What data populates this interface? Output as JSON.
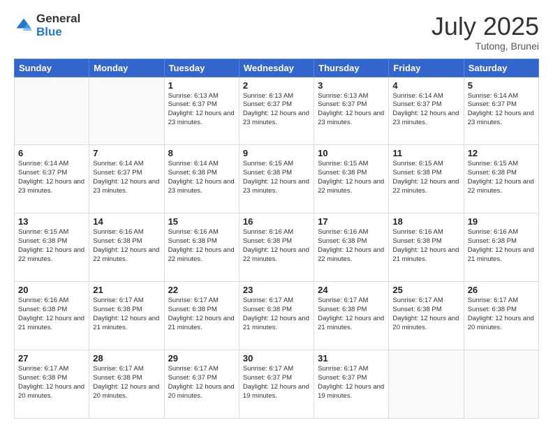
{
  "logo": {
    "general": "General",
    "blue": "Blue"
  },
  "title": "July 2025",
  "subtitle": "Tutong, Brunei",
  "days_header": [
    "Sunday",
    "Monday",
    "Tuesday",
    "Wednesday",
    "Thursday",
    "Friday",
    "Saturday"
  ],
  "weeks": [
    [
      {
        "day": "",
        "sunrise": "",
        "sunset": "",
        "daylight": ""
      },
      {
        "day": "",
        "sunrise": "",
        "sunset": "",
        "daylight": ""
      },
      {
        "day": "1",
        "sunrise": "Sunrise: 6:13 AM",
        "sunset": "Sunset: 6:37 PM",
        "daylight": "Daylight: 12 hours and 23 minutes."
      },
      {
        "day": "2",
        "sunrise": "Sunrise: 6:13 AM",
        "sunset": "Sunset: 6:37 PM",
        "daylight": "Daylight: 12 hours and 23 minutes."
      },
      {
        "day": "3",
        "sunrise": "Sunrise: 6:13 AM",
        "sunset": "Sunset: 6:37 PM",
        "daylight": "Daylight: 12 hours and 23 minutes."
      },
      {
        "day": "4",
        "sunrise": "Sunrise: 6:14 AM",
        "sunset": "Sunset: 6:37 PM",
        "daylight": "Daylight: 12 hours and 23 minutes."
      },
      {
        "day": "5",
        "sunrise": "Sunrise: 6:14 AM",
        "sunset": "Sunset: 6:37 PM",
        "daylight": "Daylight: 12 hours and 23 minutes."
      }
    ],
    [
      {
        "day": "6",
        "sunrise": "Sunrise: 6:14 AM",
        "sunset": "Sunset: 6:37 PM",
        "daylight": "Daylight: 12 hours and 23 minutes."
      },
      {
        "day": "7",
        "sunrise": "Sunrise: 6:14 AM",
        "sunset": "Sunset: 6:37 PM",
        "daylight": "Daylight: 12 hours and 23 minutes."
      },
      {
        "day": "8",
        "sunrise": "Sunrise: 6:14 AM",
        "sunset": "Sunset: 6:38 PM",
        "daylight": "Daylight: 12 hours and 23 minutes."
      },
      {
        "day": "9",
        "sunrise": "Sunrise: 6:15 AM",
        "sunset": "Sunset: 6:38 PM",
        "daylight": "Daylight: 12 hours and 23 minutes."
      },
      {
        "day": "10",
        "sunrise": "Sunrise: 6:15 AM",
        "sunset": "Sunset: 6:38 PM",
        "daylight": "Daylight: 12 hours and 22 minutes."
      },
      {
        "day": "11",
        "sunrise": "Sunrise: 6:15 AM",
        "sunset": "Sunset: 6:38 PM",
        "daylight": "Daylight: 12 hours and 22 minutes."
      },
      {
        "day": "12",
        "sunrise": "Sunrise: 6:15 AM",
        "sunset": "Sunset: 6:38 PM",
        "daylight": "Daylight: 12 hours and 22 minutes."
      }
    ],
    [
      {
        "day": "13",
        "sunrise": "Sunrise: 6:15 AM",
        "sunset": "Sunset: 6:38 PM",
        "daylight": "Daylight: 12 hours and 22 minutes."
      },
      {
        "day": "14",
        "sunrise": "Sunrise: 6:16 AM",
        "sunset": "Sunset: 6:38 PM",
        "daylight": "Daylight: 12 hours and 22 minutes."
      },
      {
        "day": "15",
        "sunrise": "Sunrise: 6:16 AM",
        "sunset": "Sunset: 6:38 PM",
        "daylight": "Daylight: 12 hours and 22 minutes."
      },
      {
        "day": "16",
        "sunrise": "Sunrise: 6:16 AM",
        "sunset": "Sunset: 6:38 PM",
        "daylight": "Daylight: 12 hours and 22 minutes."
      },
      {
        "day": "17",
        "sunrise": "Sunrise: 6:16 AM",
        "sunset": "Sunset: 6:38 PM",
        "daylight": "Daylight: 12 hours and 22 minutes."
      },
      {
        "day": "18",
        "sunrise": "Sunrise: 6:16 AM",
        "sunset": "Sunset: 6:38 PM",
        "daylight": "Daylight: 12 hours and 21 minutes."
      },
      {
        "day": "19",
        "sunrise": "Sunrise: 6:16 AM",
        "sunset": "Sunset: 6:38 PM",
        "daylight": "Daylight: 12 hours and 21 minutes."
      }
    ],
    [
      {
        "day": "20",
        "sunrise": "Sunrise: 6:16 AM",
        "sunset": "Sunset: 6:38 PM",
        "daylight": "Daylight: 12 hours and 21 minutes."
      },
      {
        "day": "21",
        "sunrise": "Sunrise: 6:17 AM",
        "sunset": "Sunset: 6:38 PM",
        "daylight": "Daylight: 12 hours and 21 minutes."
      },
      {
        "day": "22",
        "sunrise": "Sunrise: 6:17 AM",
        "sunset": "Sunset: 6:38 PM",
        "daylight": "Daylight: 12 hours and 21 minutes."
      },
      {
        "day": "23",
        "sunrise": "Sunrise: 6:17 AM",
        "sunset": "Sunset: 6:38 PM",
        "daylight": "Daylight: 12 hours and 21 minutes."
      },
      {
        "day": "24",
        "sunrise": "Sunrise: 6:17 AM",
        "sunset": "Sunset: 6:38 PM",
        "daylight": "Daylight: 12 hours and 21 minutes."
      },
      {
        "day": "25",
        "sunrise": "Sunrise: 6:17 AM",
        "sunset": "Sunset: 6:38 PM",
        "daylight": "Daylight: 12 hours and 20 minutes."
      },
      {
        "day": "26",
        "sunrise": "Sunrise: 6:17 AM",
        "sunset": "Sunset: 6:38 PM",
        "daylight": "Daylight: 12 hours and 20 minutes."
      }
    ],
    [
      {
        "day": "27",
        "sunrise": "Sunrise: 6:17 AM",
        "sunset": "Sunset: 6:38 PM",
        "daylight": "Daylight: 12 hours and 20 minutes."
      },
      {
        "day": "28",
        "sunrise": "Sunrise: 6:17 AM",
        "sunset": "Sunset: 6:38 PM",
        "daylight": "Daylight: 12 hours and 20 minutes."
      },
      {
        "day": "29",
        "sunrise": "Sunrise: 6:17 AM",
        "sunset": "Sunset: 6:37 PM",
        "daylight": "Daylight: 12 hours and 20 minutes."
      },
      {
        "day": "30",
        "sunrise": "Sunrise: 6:17 AM",
        "sunset": "Sunset: 6:37 PM",
        "daylight": "Daylight: 12 hours and 19 minutes."
      },
      {
        "day": "31",
        "sunrise": "Sunrise: 6:17 AM",
        "sunset": "Sunset: 6:37 PM",
        "daylight": "Daylight: 12 hours and 19 minutes."
      },
      {
        "day": "",
        "sunrise": "",
        "sunset": "",
        "daylight": ""
      },
      {
        "day": "",
        "sunrise": "",
        "sunset": "",
        "daylight": ""
      }
    ]
  ]
}
